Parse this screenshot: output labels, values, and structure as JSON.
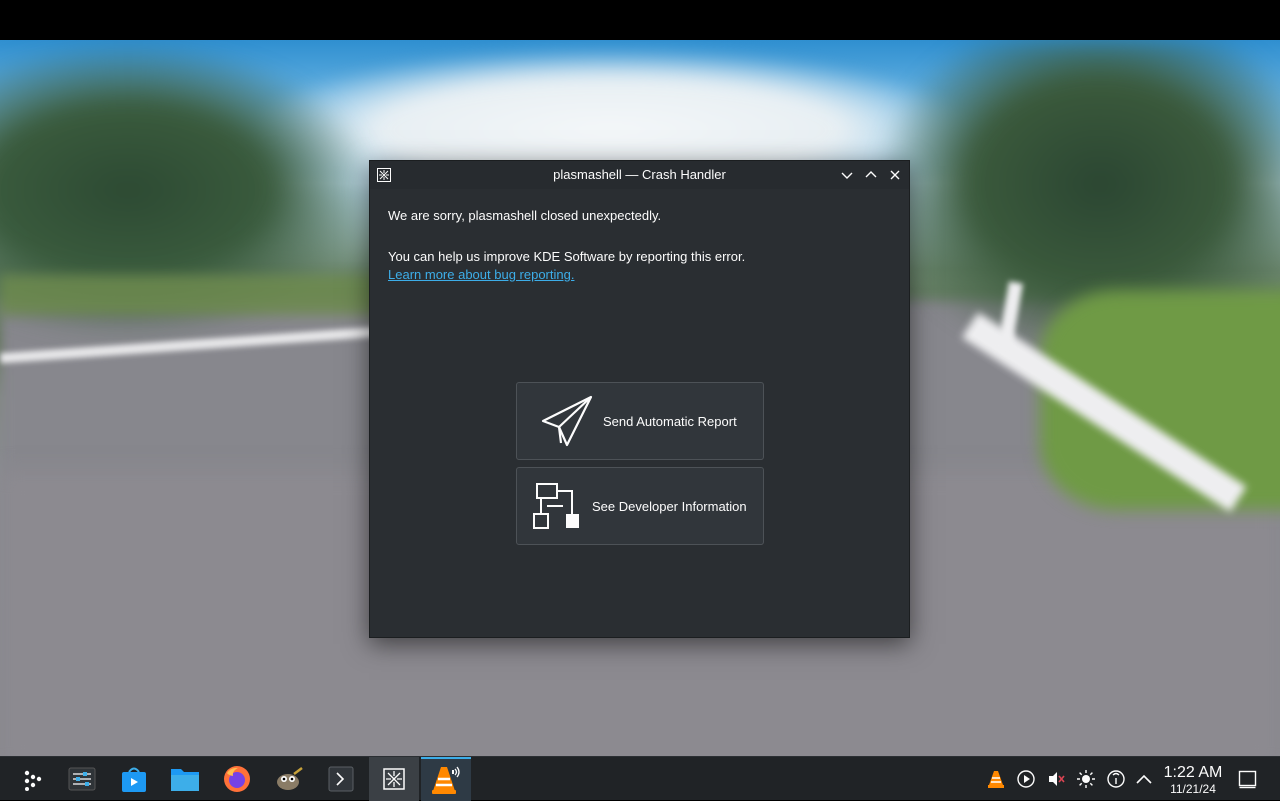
{
  "dialog": {
    "title": "plasmashell — Crash Handler",
    "message": "We are sorry, plasmashell closed unexpectedly.",
    "help_text": "You can help us improve KDE Software by reporting this error.",
    "link_text": "Learn more about bug reporting.",
    "buttons": {
      "send_report": "Send Automatic Report",
      "dev_info": "See Developer Information"
    },
    "titlebar_icons": [
      "crash-handler-icon",
      "minimize-icon",
      "maximize-icon",
      "close-icon"
    ]
  },
  "taskbar": {
    "launchers": [
      "application-launcher-icon",
      "system-settings-icon",
      "discover-icon",
      "files-icon",
      "firefox-icon",
      "gimp-icon",
      "konsole-icon",
      "crash-handler-icon",
      "vlc-icon"
    ],
    "tray_icons": [
      "vlc-tray-icon",
      "media-player-icon",
      "volume-muted-icon",
      "brightness-icon",
      "network-icon",
      "show-hidden-icon"
    ],
    "clock": {
      "time": "1:22 AM",
      "date": "11/21/24"
    }
  },
  "colors": {
    "accent": "#3daee9",
    "dialog_bg": "#2a2e32",
    "taskbar_bg": "#202326"
  }
}
